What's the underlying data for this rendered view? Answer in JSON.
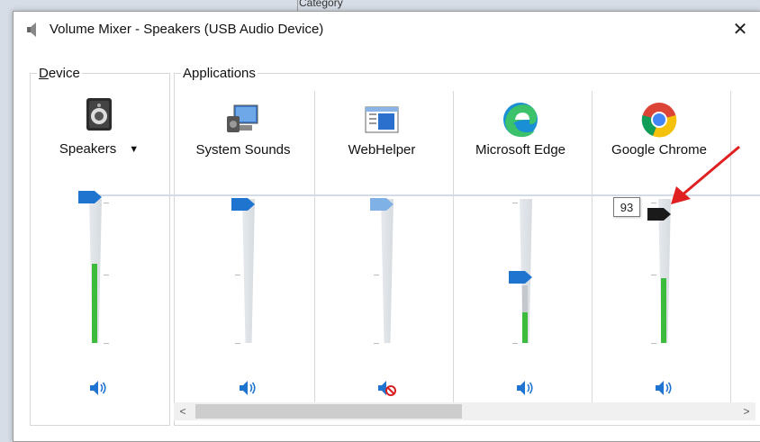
{
  "background_window": {
    "category_label": "Category"
  },
  "window": {
    "title": "Volume Mixer - Speakers (USB Audio Device)",
    "close_glyph": "✕"
  },
  "groups": {
    "device_label_first": "D",
    "device_label_rest": "evice",
    "applications_label": "Applications"
  },
  "device": {
    "name": "Speakers",
    "icon": "speaker-device-icon",
    "volume_fraction": 1.0,
    "mute_icon": "volume-icon"
  },
  "apps": [
    {
      "name": "System Sounds",
      "icon": "system-sounds-icon",
      "volume_fraction": 1.0,
      "muted": false
    },
    {
      "name": "WebHelper",
      "icon": "webhelper-icon",
      "volume_fraction": 1.0,
      "muted": true
    },
    {
      "name": "Microsoft Edge",
      "icon": "microsoft-edge-icon",
      "volume_fraction": 0.47,
      "muted": false
    },
    {
      "name": "Google Chrome",
      "icon": "google-chrome-icon",
      "volume_fraction": 0.93,
      "muted": false
    }
  ],
  "tooltip": {
    "value": "93"
  },
  "scroll": {
    "left_arrow": "<",
    "right_arrow": ">"
  },
  "colors": {
    "thumb_blue": "#1f74d0",
    "thumb_active": "#1a1a1a",
    "peak_green": "#3dbb3d",
    "annotation_arrow": "#e02020"
  }
}
